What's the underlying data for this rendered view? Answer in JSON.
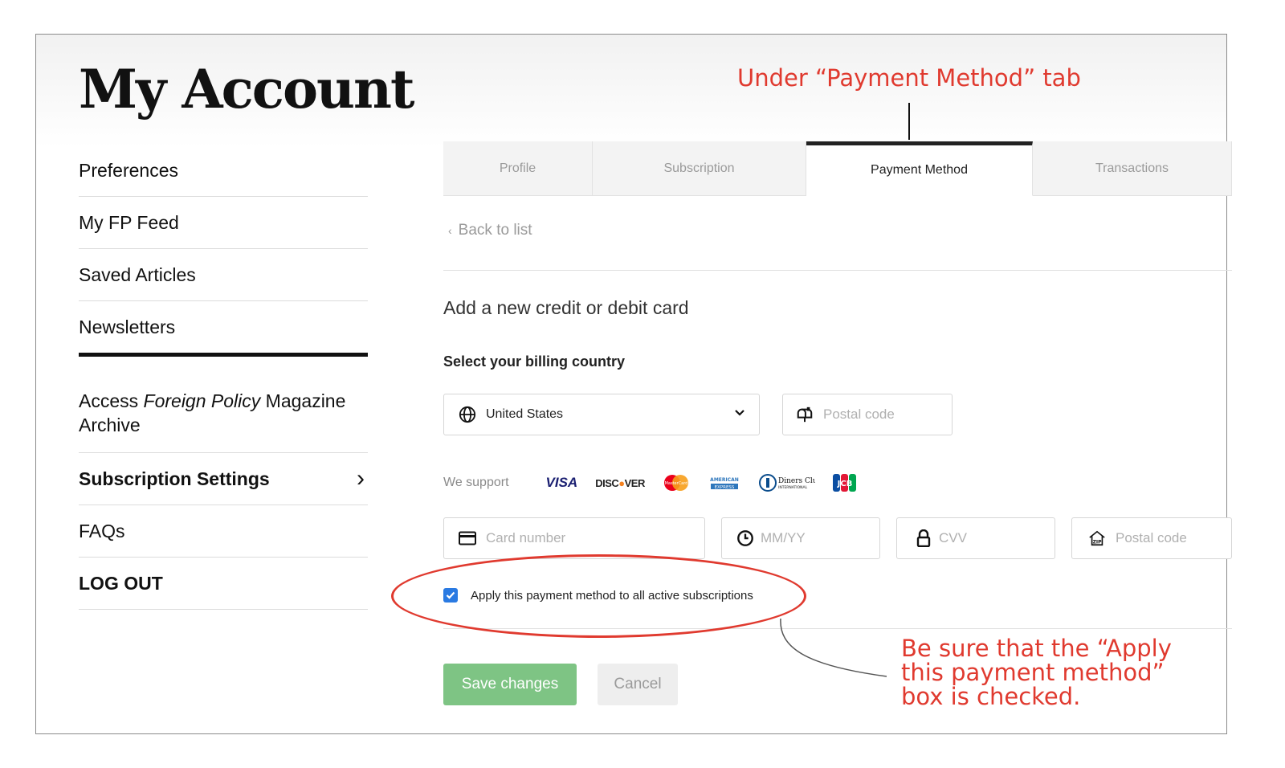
{
  "page": {
    "title": "My Account"
  },
  "sidebar": {
    "items": [
      {
        "label": "Preferences"
      },
      {
        "label": "My FP Feed"
      },
      {
        "label": "Saved Articles"
      },
      {
        "label": "Newsletters"
      }
    ],
    "archive": {
      "prefix": "Access ",
      "italic": "Foreign Policy",
      "suffix": " Magazine Archive"
    },
    "subscription_settings": {
      "label": "Subscription Settings"
    },
    "faqs": {
      "label": "FAQs"
    },
    "logout": {
      "label": "LOG OUT"
    }
  },
  "tabs": [
    {
      "label": "Profile",
      "active": false
    },
    {
      "label": "Subscription",
      "active": false
    },
    {
      "label": "Payment Method",
      "active": true
    },
    {
      "label": "Transactions",
      "active": false
    }
  ],
  "main": {
    "back_link": "Back to list",
    "heading": "Add a new credit or debit card",
    "billing_label": "Select your billing country",
    "country": {
      "selected": "United States"
    },
    "postal_code_placeholder": "Postal code",
    "support_label": "We support",
    "cards": [
      "VISA",
      "DISCOVER",
      "MasterCard",
      "AMERICAN EXPRESS",
      "Diners Club INTERNATIONAL",
      "JCB"
    ],
    "card_number_placeholder": "Card number",
    "expiry_placeholder": "MM/YY",
    "cvv_placeholder": "CVV",
    "card_postal_placeholder": "Postal code",
    "apply_checkbox": {
      "label": "Apply this payment method to all active subscriptions",
      "checked": true
    },
    "save_button": "Save changes",
    "cancel_button": "Cancel"
  },
  "annotations": {
    "tab_note": "Under “Payment Method” tab",
    "checkbox_note": "Be sure that the “Apply this payment method” box is checked.",
    "color": "#e03a2f"
  },
  "colors": {
    "save_button": "#7ec484",
    "checkbox": "#2a7ae2",
    "annotation": "#e03a2f"
  }
}
